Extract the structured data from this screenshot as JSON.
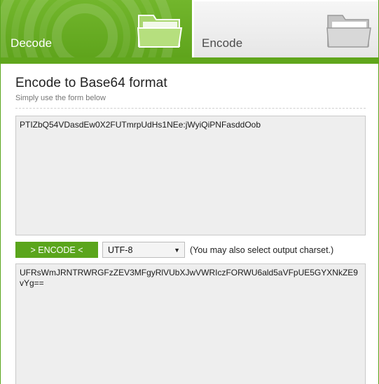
{
  "tabs": {
    "decode": {
      "label": "Decode"
    },
    "encode": {
      "label": "Encode"
    }
  },
  "main": {
    "heading": "Encode to Base64 format",
    "subheading": "Simply use the form below",
    "input_text": "PTIZbQ54VDasdEw0X2FUTmrpUdHs1NEe:jWyiQiPNFasddOob",
    "encode_button": "> ENCODE <",
    "charset": {
      "selected": "UTF-8"
    },
    "charset_note": "(You may also select output charset.)",
    "output_text": "UFRsWmJRNTRWRGFzZEV3MFgyRlVUbXJwVWRIczFORWU6ald5aVFpUE5GYXNkZE9vYg=="
  },
  "colors": {
    "brand_green": "#5fa41c",
    "tab_inactive": "#efefef",
    "textarea_bg": "#eeeeee"
  }
}
